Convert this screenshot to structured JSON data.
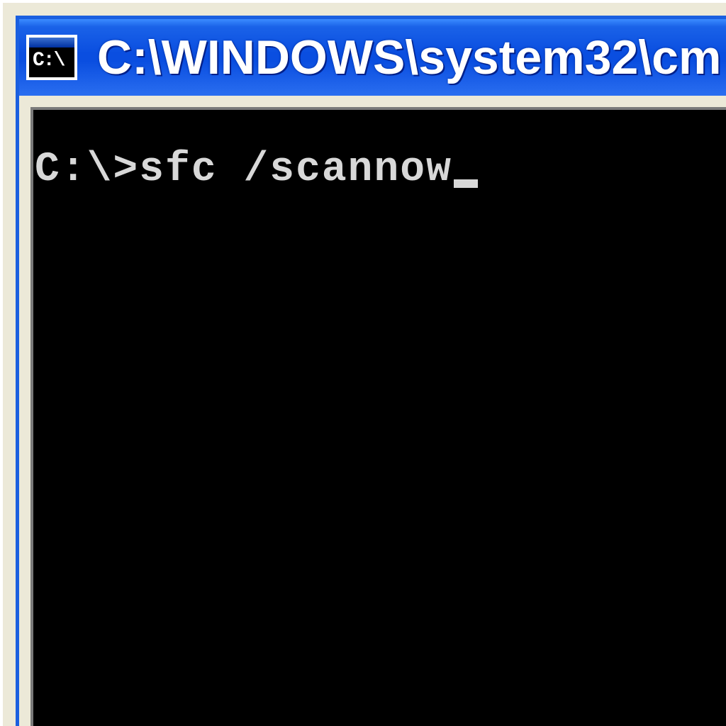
{
  "window": {
    "icon_label": "C:\\",
    "title": "C:\\WINDOWS\\system32\\cm"
  },
  "console": {
    "prompt": "C:\\>",
    "command": "sfc /scannow"
  }
}
